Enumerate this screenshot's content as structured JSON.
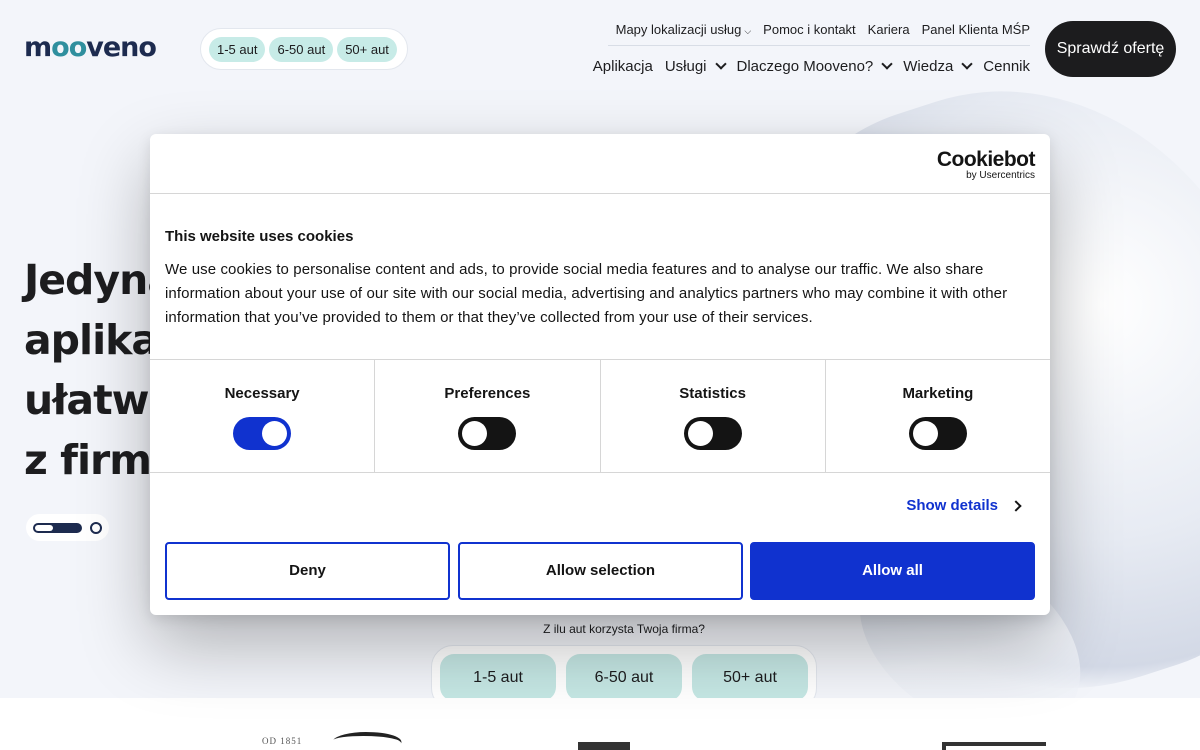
{
  "brand": {
    "logo_text_a": "m",
    "logo_text_oo": "oo",
    "logo_text_b": "veno"
  },
  "fleet_pills_header": [
    "1-5 aut",
    "6-50 aut",
    "50+ aut"
  ],
  "top_nav": {
    "map_label": "Mapy lokalizacji usług",
    "help_label": "Pomoc i kontakt",
    "career_label": "Kariera",
    "panel_label": "Panel Klienta MŚP"
  },
  "main_nav": {
    "app": "Aplikacja",
    "services": "Usługi",
    "why": "Dlaczego Mooveno?",
    "knowledge": "Wiedza",
    "pricing": "Cennik"
  },
  "cta_label": "Sprawdź ofertę",
  "hero": {
    "line1": "Jedyna",
    "line2": "aplikac",
    "line3": "ułatwia",
    "line4": "z firmo"
  },
  "fleet_question": "Z ilu aut korzysta Twoja firma?",
  "fleet_buttons": [
    "1-5 aut",
    "6-50 aut",
    "50+ aut"
  ],
  "logos": {
    "logo_a_text": "OD 1851"
  },
  "cookie": {
    "logo_name": "Cookiebot",
    "logo_by": "by Usercentrics",
    "title": "This website uses cookies",
    "text": "We use cookies to personalise content and ads, to provide social media features and to analyse our traffic. We also share information about your use of our site with our social media, advertising and analytics partners who may combine it with other information that you’ve provided to them or that they’ve collected from your use of their services.",
    "categories": [
      {
        "label": "Necessary",
        "enabled": true
      },
      {
        "label": "Preferences",
        "enabled": false
      },
      {
        "label": "Statistics",
        "enabled": false
      },
      {
        "label": "Marketing",
        "enabled": false
      }
    ],
    "show_details": "Show details",
    "deny": "Deny",
    "allow_selection": "Allow selection",
    "allow_all": "Allow all"
  },
  "colors": {
    "accent_blue": "#1032cf",
    "brand_navy": "#1d2b4f",
    "mint_pill": "#c7ebe7",
    "cta_dark": "#1c1c1e"
  }
}
